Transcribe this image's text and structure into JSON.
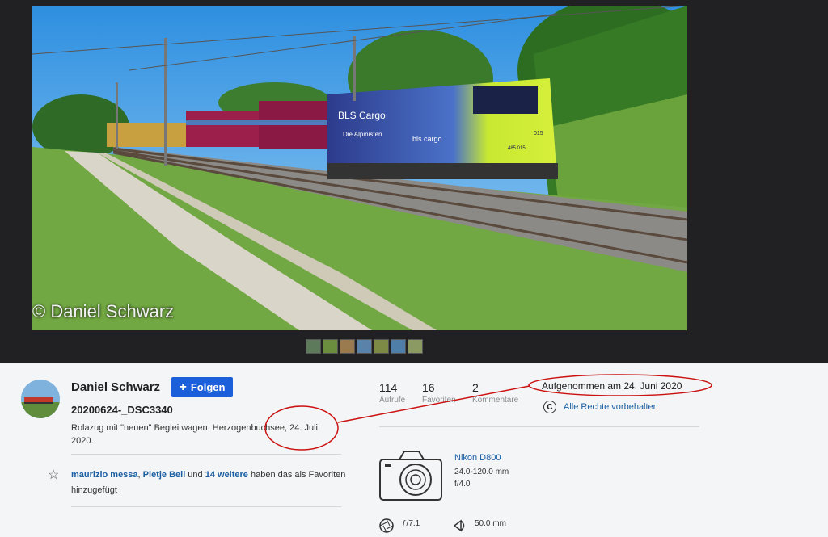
{
  "photo": {
    "watermark": "© Daniel Schwarz",
    "loco_brand": "BLS Cargo",
    "loco_slogan": "Die Alpinisten",
    "loco_logo": "bls cargo",
    "loco_number": "015",
    "loco_fullnumber": "485 015"
  },
  "filmstrip": {
    "count": 7
  },
  "author": {
    "name": "Daniel Schwarz",
    "follow_label": "Folgen"
  },
  "photo_title": "20200624-_DSC3340",
  "description": "Rolazug mit \"neuen\" Begleitwagen. Herzogenbuchsee, 24. Juli 2020.",
  "favorites": {
    "user1": "maurizio messa",
    "sep": ", ",
    "user2": "Pietje Bell",
    "und": " und ",
    "more": "14 weitere",
    "suffix": " haben das als Favoriten hinzugefügt"
  },
  "stats": [
    {
      "value": "114",
      "label": "Aufrufe"
    },
    {
      "value": "16",
      "label": "Favoriten"
    },
    {
      "value": "2",
      "label": "Kommentare"
    }
  ],
  "taken": "Aufgenommen am 24. Juni 2020",
  "rights": {
    "icon": "C",
    "label": "Alle Rechte vorbehalten"
  },
  "camera": {
    "model": "Nikon D800",
    "lens": "24.0-120.0 mm",
    "aperture": "f/4.0"
  },
  "exif": {
    "aperture": "ƒ/7.1",
    "focal_length": "50.0 mm"
  },
  "colors": {
    "accent": "#1c5fdb",
    "link": "#1a5ea3",
    "annotation": "#cc1111"
  }
}
